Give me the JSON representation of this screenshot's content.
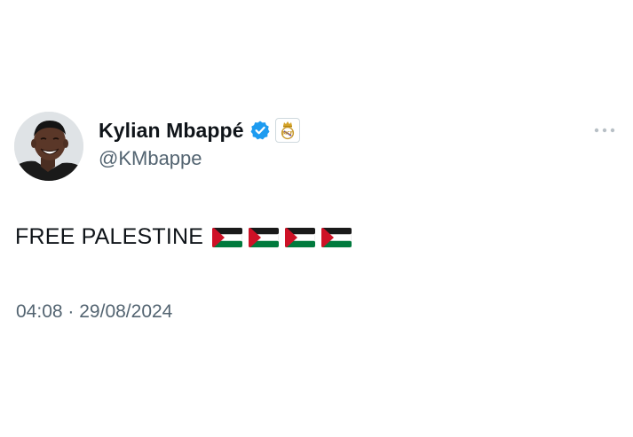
{
  "tweet": {
    "author": {
      "display_name": "Kylian Mbappé",
      "handle": "@KMbappe",
      "verified_icon": "verified-badge-icon",
      "affiliation_icon": "real-madrid-crest-icon",
      "avatar": "profile-photo"
    },
    "text": "FREE PALESTINE",
    "emoji": [
      "palestine-flag",
      "palestine-flag",
      "palestine-flag",
      "palestine-flag"
    ],
    "time": "04:08",
    "separator": "·",
    "date": "29/08/2024",
    "more_icon": "more-options-icon"
  },
  "colors": {
    "text_primary": "#0f1419",
    "text_secondary": "#536471",
    "verified_blue": "#1d9bf0",
    "flag_red": "#ce1126",
    "flag_green": "#007a3d"
  }
}
